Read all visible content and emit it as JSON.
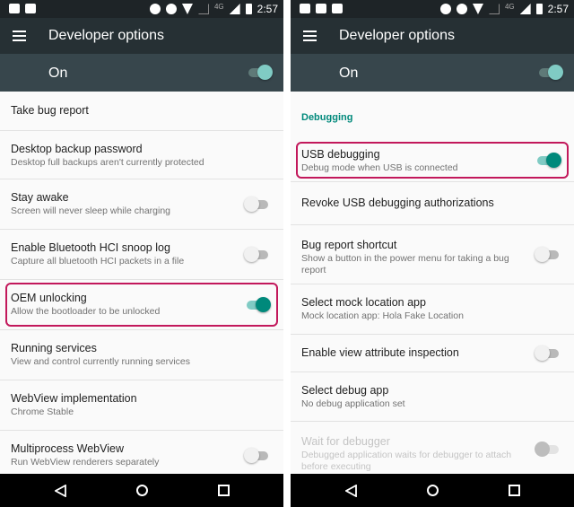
{
  "status": {
    "time": "2:57",
    "network": "4G"
  },
  "colors": {
    "accent": "#00897b",
    "highlight": "#c2185b",
    "toolbar": "#263034",
    "onbar": "#37464c"
  },
  "screens": [
    {
      "title": "Developer options",
      "master_label": "On",
      "master_on": true,
      "rows": [
        {
          "h": 44,
          "label": "Take bug report"
        },
        {
          "h": 54,
          "label": "Desktop backup password",
          "sub": "Desktop full backups aren't currently protected"
        },
        {
          "h": 56,
          "label": "Stay awake",
          "sub": "Screen will never sleep while charging",
          "toggle": false
        },
        {
          "h": 56,
          "label": "Enable Bluetooth HCI snoop log",
          "sub": "Capture all bluetooth HCI packets in a file",
          "toggle": false
        },
        {
          "h": 56,
          "label": "OEM unlocking",
          "sub": "Allow the bootloader to be unlocked",
          "toggle": true,
          "highlight": true
        },
        {
          "h": 56,
          "label": "Running services",
          "sub": "View and control currently running services"
        },
        {
          "h": 56,
          "label": "WebView implementation",
          "sub": "Chrome Stable"
        },
        {
          "h": 56,
          "label": "Multiprocess WebView",
          "sub": "Run WebView renderers separately",
          "toggle": false
        }
      ]
    },
    {
      "title": "Developer options",
      "master_label": "On",
      "master_on": true,
      "rows": [
        {
          "h": 53,
          "category": "Debugging"
        },
        {
          "h": 48,
          "label": "USB debugging",
          "sub": "Debug mode when USB is connected",
          "toggle": true,
          "highlight": true
        },
        {
          "h": 48,
          "label": "Revoke USB debugging authorizations"
        },
        {
          "h": 66,
          "label": "Bug report shortcut",
          "sub": "Show a button in the power menu for taking a bug report",
          "toggle": false
        },
        {
          "h": 56,
          "label": "Select mock location app",
          "sub": "Mock location app: Hola Fake Location"
        },
        {
          "h": 42,
          "label": "Enable view attribute inspection",
          "toggle": false
        },
        {
          "h": 55,
          "label": "Select debug app",
          "sub": "No debug application set"
        },
        {
          "h": 62,
          "label": "Wait for debugger",
          "sub": "Debugged application waits for debugger to attach before executing",
          "toggle": false,
          "disabled": true
        }
      ]
    }
  ]
}
